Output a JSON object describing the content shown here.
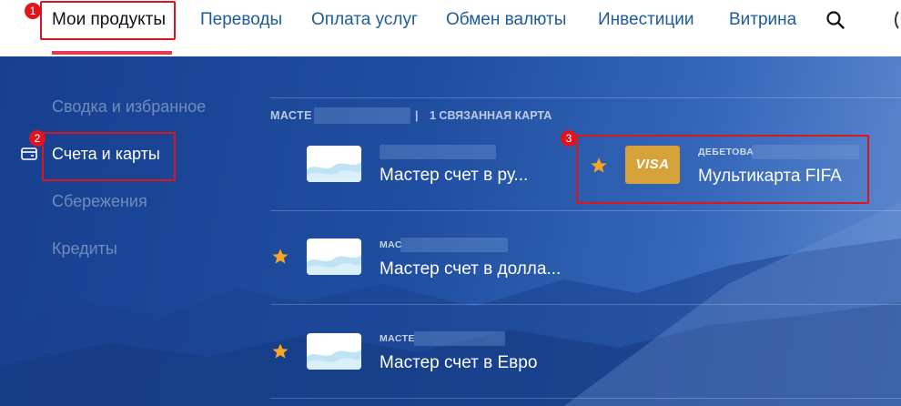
{
  "topnav": {
    "items": [
      {
        "label": "Мои продукты",
        "active": true
      },
      {
        "label": "Переводы"
      },
      {
        "label": "Оплата услуг"
      },
      {
        "label": "Обмен валюты"
      },
      {
        "label": "Инвестиции"
      },
      {
        "label": "Витрина"
      }
    ],
    "icons": [
      "search-icon",
      "profile-icon"
    ]
  },
  "sidebar": {
    "items": [
      {
        "label": "Сводка и избранное"
      },
      {
        "label": "Счета и карты",
        "active": true,
        "icon": "card-icon"
      },
      {
        "label": "Сбережения"
      },
      {
        "label": "Кредиты"
      }
    ]
  },
  "accounts": {
    "group_header": {
      "prefix": "МАСТЕ",
      "separator": "|",
      "linked_cards": "1 СВЯЗАННАЯ КАРТА"
    },
    "items": [
      {
        "caption": "",
        "name": "Мастер счет в ру...",
        "starred": false,
        "linked_card": {
          "caption": "ДЕБЕТОВА",
          "name": "Мультикарта FIFA",
          "brand": "VISA",
          "starred": true
        }
      },
      {
        "caption": "МАС",
        "name": "Мастер счет в долла...",
        "starred": true
      },
      {
        "caption": "МАСТЕ",
        "name": "Мастер счет в Евро",
        "starred": true
      }
    ]
  },
  "annotations": [
    "1",
    "2",
    "3"
  ],
  "colors": {
    "nav_link": "#1d5a9e",
    "accent_underline": "#e23b4f",
    "background_blue": "#1f4ea0",
    "star": "#f5a623",
    "visa_card": "#d6a23a",
    "annotation_red": "#e0141e"
  }
}
